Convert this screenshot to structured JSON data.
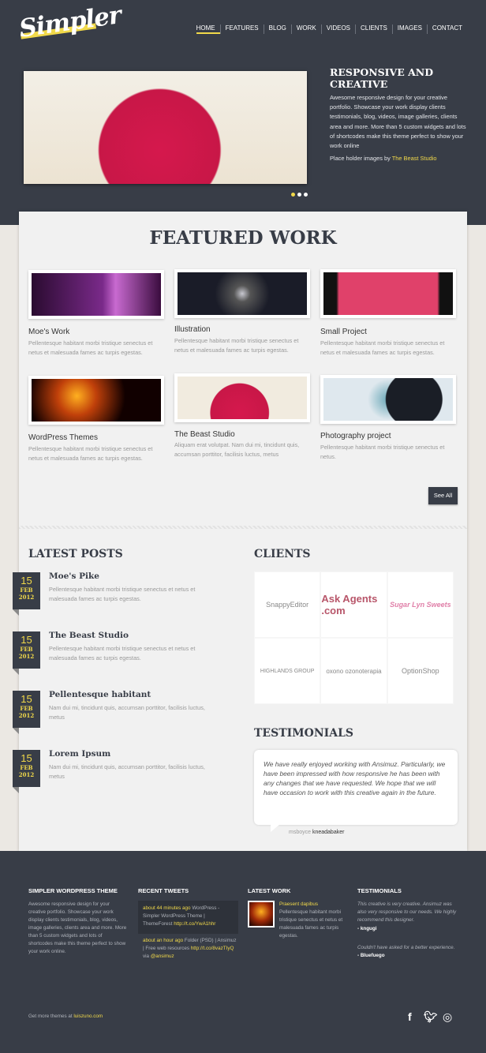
{
  "header": {
    "logo": "Simpler",
    "nav": [
      "HOME",
      "FEATURES",
      "BLOG",
      "WORK",
      "VIDEOS",
      "CLIENTS",
      "IMAGES",
      "CONTACT"
    ],
    "active_nav": "HOME"
  },
  "hero": {
    "title": "RESPONSIVE AND CREATIVE",
    "text": "Awesome responsive design for your creative portfolio. Showcase your work display clients testimonials, blog, videos, image galleries, clients area and more. More than 5 custom widgets and lots of shortcodes make this theme perfect to show your work online",
    "credit_prefix": "Place holder images by ",
    "credit_link": "The Beast Studio",
    "slide_count": 3,
    "active_slide": 1
  },
  "featured": {
    "title": "FEATURED WORK",
    "see_all": "See All",
    "items": [
      {
        "title": "Moe's Work",
        "desc": "Pellentesque habitant morbi tristique senectus et netus et malesuada fames ac turpis egestas."
      },
      {
        "title": "Illustration",
        "desc": "Pellentesque habitant morbi tristique senectus et netus et malesuada fames ac turpis egestas."
      },
      {
        "title": "Small Project",
        "desc": "Pellentesque habitant morbi tristique senectus et netus et malesuada fames ac turpis egestas."
      },
      {
        "title": "WordPress Themes",
        "desc": "Pellentesque habitant morbi tristique senectus et netus et malesuada fames ac turpis egestas."
      },
      {
        "title": "The Beast Studio",
        "desc": "Aliquam erat volutpat. Nam dui mi, tincidunt quis, accumsan porttitor, facilisis luctus, metus"
      },
      {
        "title": "Photography project",
        "desc": "Pellentesque habitant morbi tristique senectus et netus."
      }
    ]
  },
  "posts": {
    "title": "LATEST POSTS",
    "items": [
      {
        "day": "15",
        "month": "FEB",
        "year": "2012",
        "title": "Moe's Pike",
        "desc": "Pellentesque habitant morbi tristique senectus et netus et malesuada fames ac turpis egestas."
      },
      {
        "day": "15",
        "month": "FEB",
        "year": "2012",
        "title": "The Beast Studio",
        "desc": "Pellentesque habitant morbi tristique senectus et netus et malesuada fames ac turpis egestas."
      },
      {
        "day": "15",
        "month": "FEB",
        "year": "2012",
        "title": "Pellentesque habitant",
        "desc": "Nam dui mi, tincidunt quis, accumsan porttitor, facilisis luctus, metus"
      },
      {
        "day": "15",
        "month": "FEB",
        "year": "2012",
        "title": "Lorem Ipsum",
        "desc": "Nam dui mi, tincidunt quis, accumsan porttitor, facilisis luctus, metus"
      }
    ]
  },
  "clients": {
    "title": "CLIENTS",
    "logos": [
      "SnappyEditor",
      "Ask Agents .com",
      "Sugar Lyn Sweets",
      "HIGHLANDS GROUP",
      "oxono ozonoterapia",
      "OptionShop"
    ]
  },
  "testimonials": {
    "title": "TESTIMONIALS",
    "quote": "We have really enjoyed working with Ansimuz. Particularly, we have been impressed with how responsive he has been with any changes that we have requested. We hope that we will have occasion to work with this creative again in the future.",
    "author": "msboyce",
    "author_link": "kneadabaker"
  },
  "footer": {
    "about": {
      "title": "SIMPLER WORDPRESS THEME",
      "text": "Awesome responsive design for your creative portfolio. Showcase your work display clients testimonials, blog, videos, image galleries, clients area and more. More than 5 custom widgets and lots of shortcodes make this theme perfect to show your work online."
    },
    "tweets": {
      "title": "RECENT TWEETS",
      "items": [
        {
          "time": "about 44 minutes ago",
          "text": " WordPress - Simpler WordPress Theme | ThemeForest ",
          "link": "http://t.co/YwA1hhr"
        },
        {
          "time": "about an hour ago",
          "text": " Folder (PSD) | Ansimuz | Free web resources ",
          "link": "http://t.co/8vazTIyQ",
          "via": " via ",
          "handle": "@ansimuz"
        }
      ]
    },
    "work": {
      "title": "LATEST WORK",
      "item_title": "Praesent dapibus",
      "item_text": "Pellentesque habitant morbi tristique senectus et netus et malesuada fames ac turpis egestas."
    },
    "testimonials": {
      "title": "TESTIMONIALS",
      "items": [
        {
          "quote": "This creative is very creative.  Ansimuz was also very responsive to our needs. We highly recommend this designer.",
          "author": "- kngugi"
        },
        {
          "quote": "Couldn't have asked for a better experience.",
          "author": "- Bluefuego"
        }
      ]
    },
    "credit_prefix": "Get more themes at ",
    "credit_link": "luiszuno.com",
    "social": [
      "facebook-icon",
      "twitter-icon",
      "dribbble-icon"
    ]
  },
  "colors": {
    "dark": "#383d47",
    "accent": "#f1d94a",
    "panel": "#f1f1f1"
  }
}
